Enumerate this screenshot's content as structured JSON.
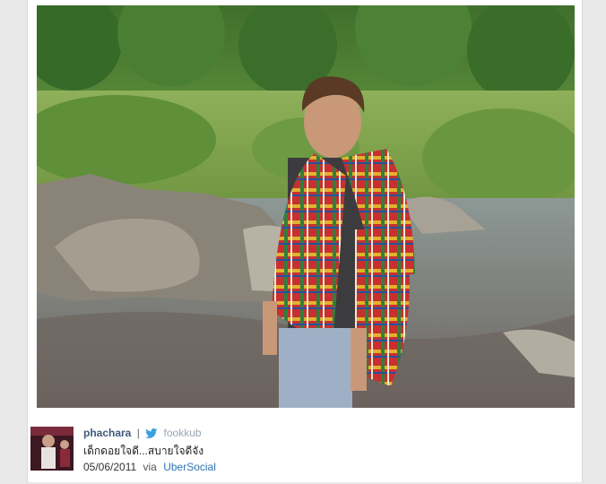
{
  "post": {
    "photo_icon": "photo-image",
    "author": {
      "display_name": "phachara",
      "separator": "|",
      "handle": "fookkub",
      "network_icon": "twitter-bird-icon"
    },
    "message": "เด็กดอยใจดี...สบายใจดีจัง",
    "date": "05/06/2011",
    "via_label": "via",
    "client": "UberSocial"
  },
  "colors": {
    "username": "#3f5a7a",
    "handle": "#9aa6b2",
    "link": "#2f73b5",
    "twitter_blue": "#3aa0e0"
  }
}
